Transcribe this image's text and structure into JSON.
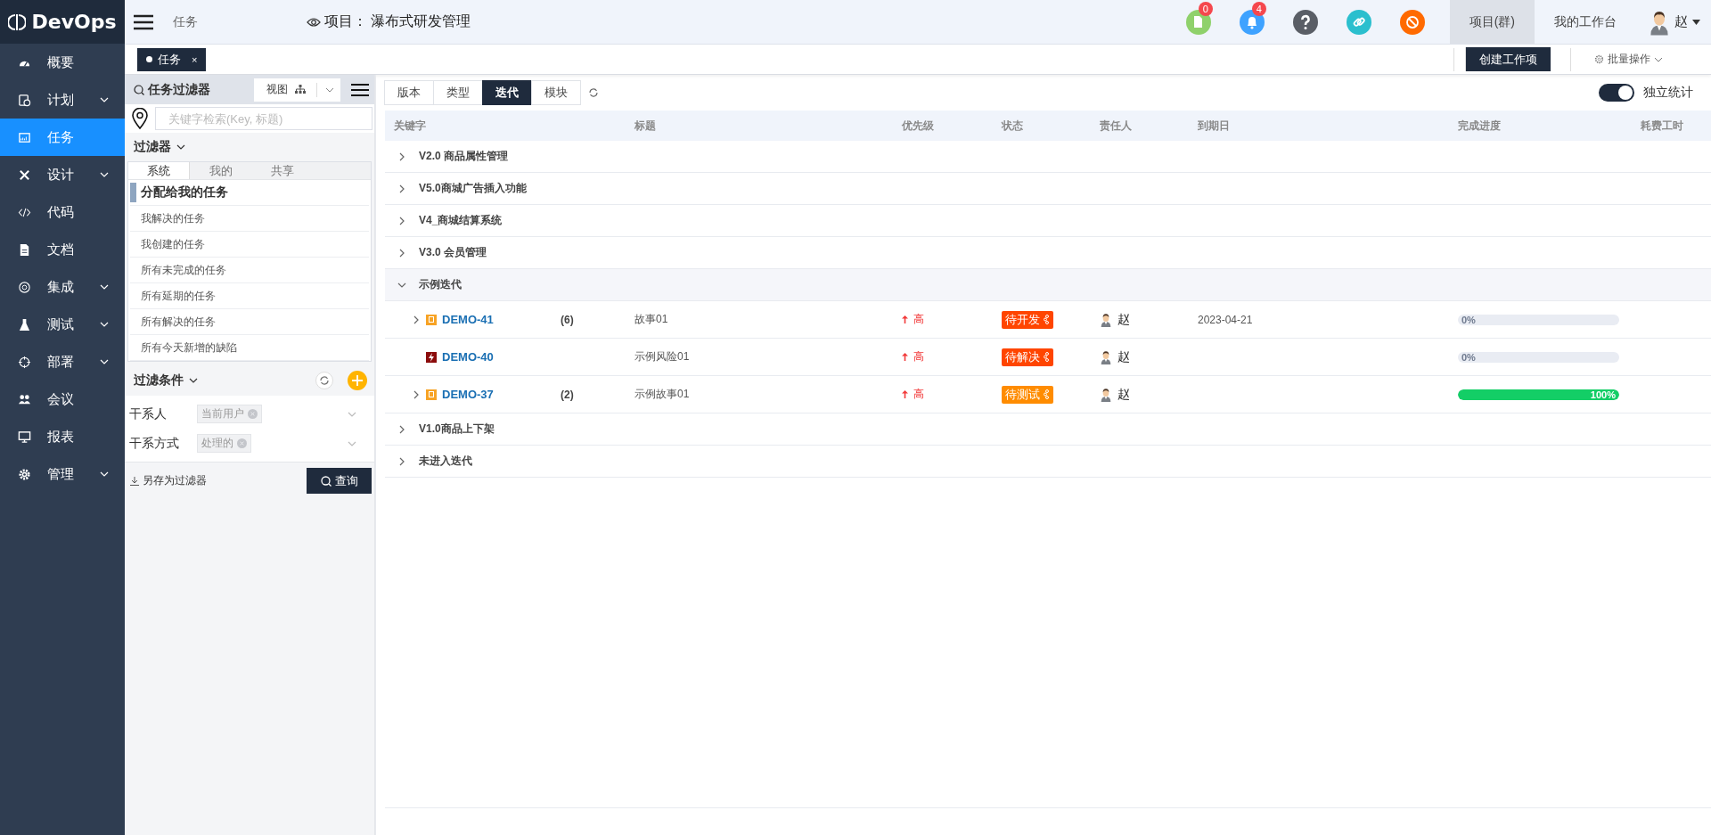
{
  "sidebar": {
    "logo": "DevOps",
    "items": [
      {
        "label": "概要",
        "expandable": false,
        "selected": false
      },
      {
        "label": "计划",
        "expandable": true,
        "selected": false
      },
      {
        "label": "任务",
        "expandable": false,
        "selected": true
      },
      {
        "label": "设计",
        "expandable": true,
        "selected": false
      },
      {
        "label": "代码",
        "expandable": false,
        "selected": false
      },
      {
        "label": "文档",
        "expandable": false,
        "selected": false
      },
      {
        "label": "集成",
        "expandable": true,
        "selected": false
      },
      {
        "label": "测试",
        "expandable": true,
        "selected": false
      },
      {
        "label": "部署",
        "expandable": true,
        "selected": false
      },
      {
        "label": "会议",
        "expandable": false,
        "selected": false
      },
      {
        "label": "报表",
        "expandable": false,
        "selected": false
      },
      {
        "label": "管理",
        "expandable": true,
        "selected": false
      }
    ]
  },
  "topbar": {
    "breadcrumb": "任务",
    "project_label": "项目：",
    "project": "瀑布式研发管理",
    "actions": [
      {
        "kind": "doc",
        "badge": "0"
      },
      {
        "kind": "bell",
        "badge": "4"
      },
      {
        "kind": "help"
      },
      {
        "kind": "link"
      },
      {
        "kind": "blocked"
      }
    ],
    "nav": [
      {
        "label": "项目(群)",
        "selected": true
      },
      {
        "label": "我的工作台",
        "selected": false
      }
    ],
    "user": "赵"
  },
  "tabbar": {
    "tabs": [
      {
        "label": "任务",
        "close": "×",
        "selected": true
      }
    ],
    "create_button": "创建工作项",
    "batch_button": "批量操作"
  },
  "filter_panel": {
    "title": "任务过滤器",
    "view_button": "视图",
    "search": {
      "placeholder": "关键字检索(Key, 标题)"
    },
    "filters_title": "过滤器",
    "filter_tabs": [
      {
        "label": "系统",
        "selected": true
      },
      {
        "label": "我的",
        "selected": false
      },
      {
        "label": "共享",
        "selected": false
      }
    ],
    "filters": [
      {
        "label": "分配给我的任务",
        "selected": true
      },
      {
        "label": "我解决的任务",
        "selected": false
      },
      {
        "label": "我创建的任务",
        "selected": false
      },
      {
        "label": "所有未完成的任务",
        "selected": false
      },
      {
        "label": "所有延期的任务",
        "selected": false
      },
      {
        "label": "所有解决的任务",
        "selected": false
      },
      {
        "label": "所有今天新增的缺陷",
        "selected": false
      }
    ],
    "conditions_title": "过滤条件",
    "conditions": [
      {
        "label": "干系人",
        "value": "当前用户"
      },
      {
        "label": "干系方式",
        "value": "处理的"
      }
    ],
    "save_link": "另存为过滤器",
    "query_button": "查询"
  },
  "main": {
    "group_tabs": [
      {
        "label": "版本",
        "selected": false
      },
      {
        "label": "类型",
        "selected": false
      },
      {
        "label": "迭代",
        "selected": true
      },
      {
        "label": "模块",
        "selected": false
      }
    ],
    "independent_stats": {
      "label": "独立统计",
      "on": true
    },
    "table": {
      "columns": [
        "关键字",
        "标题",
        "优先级",
        "状态",
        "责任人",
        "到期日",
        "完成进度",
        "耗费工时"
      ],
      "groups": [
        {
          "name": "V2.0 商品属性管理",
          "expanded": false
        },
        {
          "name": "V5.0商城广告插入功能",
          "expanded": false
        },
        {
          "name": "V4_商城结算系统",
          "expanded": false
        },
        {
          "name": "V3.0 会员管理",
          "expanded": false
        },
        {
          "name": "示例迭代",
          "expanded": true,
          "items": [
            {
              "key": "DEMO-41",
              "kind": "story",
              "expandable": true,
              "count": "(6)",
              "title": "故事01",
              "priority": "高",
              "status": {
                "label": "待开发",
                "color": "#ff4500"
              },
              "owner": "赵",
              "due": "2023-04-21",
              "progress": {
                "level": 0,
                "label": "0%"
              }
            },
            {
              "key": "DEMO-40",
              "kind": "risk",
              "expandable": false,
              "title": "示例风险01",
              "priority": "高",
              "status": {
                "label": "待解决",
                "color": "#ff4500"
              },
              "owner": "赵",
              "progress": {
                "level": 0,
                "label": "0%"
              }
            },
            {
              "key": "DEMO-37",
              "kind": "story",
              "expandable": true,
              "count": "(2)",
              "title": "示例故事01",
              "priority": "高",
              "status": {
                "label": "待测试",
                "color": "#ff8c00"
              },
              "owner": "赵",
              "progress": {
                "level": 1,
                "label": "100%"
              }
            }
          ]
        },
        {
          "name": "V1.0商品上下架",
          "expanded": false
        },
        {
          "name": "未进入迭代",
          "expanded": false
        }
      ]
    }
  }
}
